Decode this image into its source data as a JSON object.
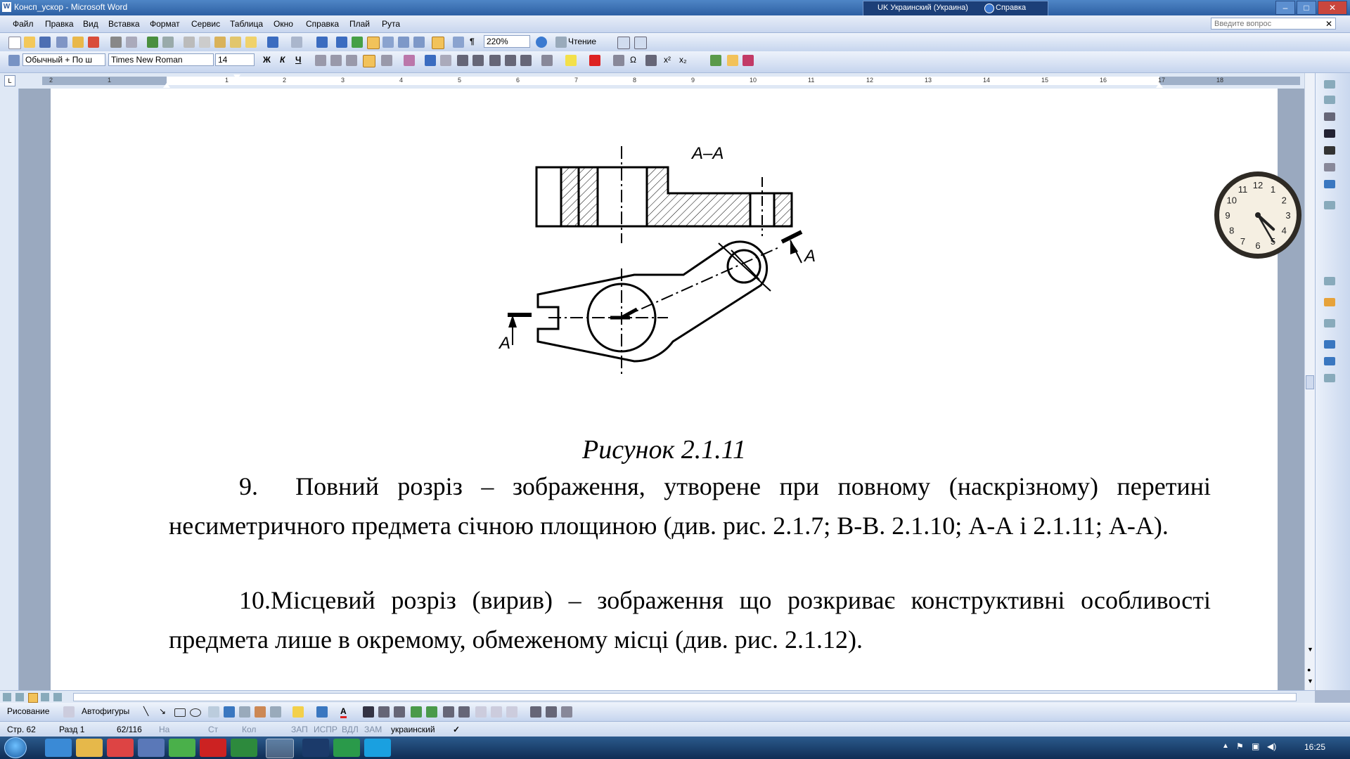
{
  "window": {
    "title": "Консп_ускор - Microsoft Word",
    "language_bar": {
      "lang": "UK Украинский (Украина)",
      "help": "Справка"
    },
    "controls": {
      "minimize": "–",
      "maximize": "□",
      "close": "✕"
    }
  },
  "menu": {
    "items": [
      "Файл",
      "Правка",
      "Вид",
      "Вставка",
      "Формат",
      "Сервис",
      "Таблица",
      "Окно",
      "Справка",
      "Плай",
      "Рута"
    ],
    "help_placeholder": "Введите вопрос"
  },
  "standard_toolbar": {
    "zoom": "220%",
    "reading_mode": "Чтение"
  },
  "format_toolbar": {
    "style": "Обычный + По ш",
    "font": "Times New Roman",
    "size": "14",
    "bold": "Ж",
    "italic": "К",
    "underline": "Ч"
  },
  "ruler": {
    "numbers": [
      "2",
      "1",
      "1",
      "2",
      "3",
      "4",
      "5",
      "6",
      "7",
      "8",
      "9",
      "10",
      "11",
      "12",
      "13",
      "14",
      "15",
      "16",
      "17",
      "18"
    ]
  },
  "document": {
    "figure": {
      "section_label": "А–А",
      "cut_label_right": "А",
      "cut_label_left": "А"
    },
    "caption": "Рисунок 2.1.11",
    "paragraphs": [
      {
        "number": "9.",
        "text": "Повний розріз – зображення, утворене при повному (наскрізному) пе­ретині несиметричного предмета січною площиною (див. рис. 2.1.7; В-В. 2.1.10; А-А і 2.1.11; А-А)."
      },
      {
        "number": "10.",
        "text": "Місцевий розріз (вирив) – зображення що розкриває конструктивні особливості предмета лише в окремому, обмеженому місці (див. рис. 2.1.12)."
      }
    ]
  },
  "drawing_toolbar": {
    "drawing": "Рисование",
    "autoshapes": "Автофигуры"
  },
  "status": {
    "page": "Стр. 62",
    "section": "Разд 1",
    "pages": "62/116",
    "at": "На",
    "line": "Ст",
    "col": "Кол",
    "rec": "ЗАП",
    "trk": "ИСПР",
    "ext": "ВДЛ",
    "ovr": "ЗАМ",
    "language": "украинский"
  },
  "taskbar": {
    "time": "16:25"
  },
  "gadget_clock": {
    "numerals": [
      "12",
      "1",
      "2",
      "3",
      "4",
      "5",
      "6",
      "7",
      "8",
      "9",
      "10",
      "11"
    ],
    "hour": 4,
    "minute": 25
  }
}
